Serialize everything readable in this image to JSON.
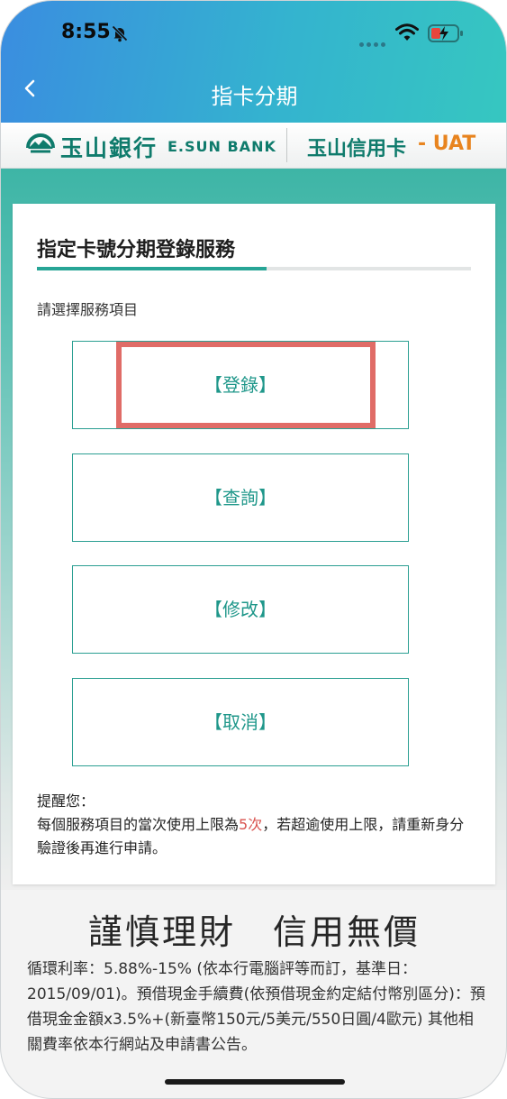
{
  "status_bar": {
    "time": "8:55"
  },
  "nav": {
    "title": "指卡分期",
    "back_icon": "chevron-left-icon"
  },
  "brand": {
    "bank_name_cn": "玉山銀行",
    "bank_name_en": "E.SUN BANK",
    "product": "玉山信用卡",
    "env_tag": "- UAT",
    "colors": {
      "brand_green": "#0f7b6c",
      "uat_orange": "#e8841f"
    }
  },
  "card": {
    "title": "指定卡號分期登錄服務",
    "subtitle": "請選擇服務項目",
    "options": [
      {
        "label": "【登錄】",
        "highlighted": true
      },
      {
        "label": "【查詢】"
      },
      {
        "label": "【修改】"
      },
      {
        "label": "【取消】"
      }
    ],
    "reminder": {
      "heading": "提醒您：",
      "text_before": "每個服務項目的當次使用上限為",
      "limit": "5次",
      "text_after": "，若超逾使用上限，請重新身分驗證後再進行申請。"
    }
  },
  "footer": {
    "slogan": "謹慎理財　信用無價",
    "fine_print": "循環利率：5.88%-15% (依本行電腦評等而訂，基準日：2015/09/01)。預借現金手續費(依預借現金約定結付幣別區分)：預借現金金額x3.5%+(新臺幣150元/5美元/550日圓/4歐元) 其他相關費率依本行網站及申請書公告。"
  },
  "colors": {
    "accent_teal": "#27a596",
    "highlight_red": "#e06c67",
    "reminder_red": "#d9534f"
  }
}
